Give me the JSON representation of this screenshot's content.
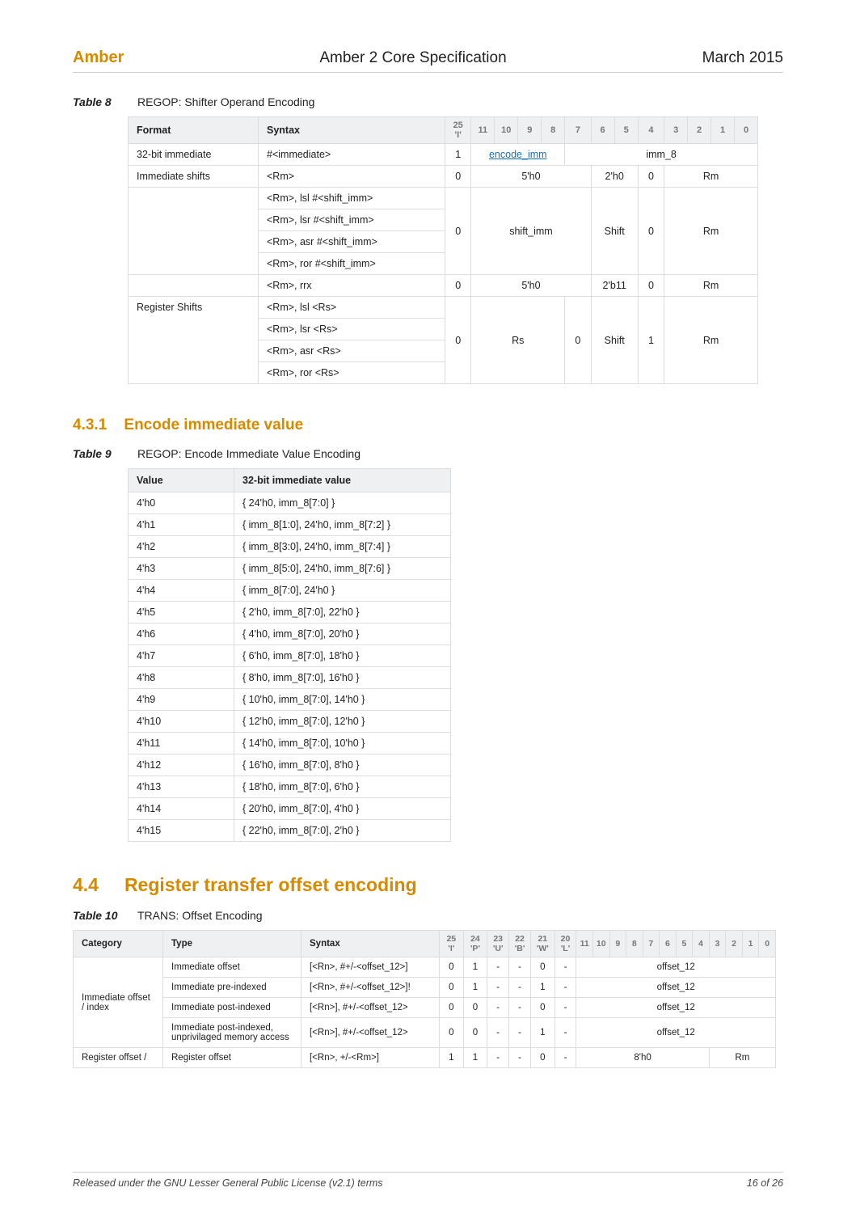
{
  "header": {
    "brand": "Amber",
    "title": "Amber 2 Core Specification",
    "date": "March 2015"
  },
  "table8": {
    "label": "Table 8",
    "caption": "REGOP: Shifter Operand Encoding",
    "headers": {
      "format": "Format",
      "syntax": "Syntax",
      "bit25": "25 'I'",
      "bits": [
        "11",
        "10",
        "9",
        "8",
        "7",
        "6",
        "5",
        "4",
        "3",
        "2",
        "1",
        "0"
      ]
    },
    "rows": [
      {
        "format": "32-bit immediate",
        "syntax": "#<immediate>",
        "i25": "1",
        "col_11_8": "encode_imm",
        "col_11_8_link": true,
        "col_7_0": "imm_8"
      },
      {
        "format": "Immediate shifts",
        "syntax": "<Rm>",
        "i25": "0",
        "col_11_7": "5'h0",
        "col_6_5": "2'h0",
        "col_4": "0",
        "col_3_0": "Rm"
      },
      {
        "format": "",
        "syntax": "<Rm>, lsl #<shift_imm>",
        "i25": "0",
        "col_11_7": "shift_imm",
        "col_6_5": "Shift",
        "col_4": "0",
        "col_3_0": "Rm",
        "grouped_below": true
      },
      {
        "format": "",
        "syntax": "<Rm>, lsr #<shift_imm>",
        "continuation": true
      },
      {
        "format": "",
        "syntax": "<Rm>, asr #<shift_imm>",
        "continuation": true
      },
      {
        "format": "",
        "syntax": "<Rm>, ror #<shift_imm>",
        "continuation": true
      },
      {
        "format": "",
        "syntax": "<Rm>, rrx",
        "i25": "0",
        "col_11_7": "5'h0",
        "col_6_5": "2'b11",
        "col_4": "0",
        "col_3_0": "Rm"
      },
      {
        "format": "Register Shifts",
        "syntax": "<Rm>, lsl <Rs>",
        "i25": "0",
        "col_11_8b": "Rs",
        "col_7": "0",
        "col_6_5": "Shift",
        "col_4": "1",
        "col_3_0": "Rm",
        "grouped_below": true
      },
      {
        "format": "",
        "syntax": "<Rm>, lsr <Rs>",
        "continuation": true
      },
      {
        "format": "",
        "syntax": "<Rm>, asr <Rs>",
        "continuation": true
      },
      {
        "format": "",
        "syntax": "<Rm>, ror <Rs>",
        "continuation": true
      }
    ]
  },
  "section431": {
    "number": "4.3.1",
    "title": "Encode immediate value"
  },
  "table9": {
    "label": "Table 9",
    "caption": "REGOP: Encode Immediate Value Encoding",
    "headers": {
      "value": "Value",
      "imm": "32-bit immediate value"
    },
    "rows": [
      {
        "v": "4'h0",
        "i": "{ 24'h0, imm_8[7:0] }"
      },
      {
        "v": "4'h1",
        "i": "{ imm_8[1:0], 24'h0, imm_8[7:2] }"
      },
      {
        "v": "4'h2",
        "i": "{ imm_8[3:0], 24'h0, imm_8[7:4] }"
      },
      {
        "v": "4'h3",
        "i": "{ imm_8[5:0], 24'h0, imm_8[7:6] }"
      },
      {
        "v": "4'h4",
        "i": "{ imm_8[7:0], 24'h0 }"
      },
      {
        "v": "4'h5",
        "i": "{ 2'h0, imm_8[7:0], 22'h0 }"
      },
      {
        "v": "4'h6",
        "i": "{ 4'h0, imm_8[7:0], 20'h0 }"
      },
      {
        "v": "4'h7",
        "i": "{ 6'h0, imm_8[7:0], 18'h0 }"
      },
      {
        "v": "4'h8",
        "i": "{ 8'h0, imm_8[7:0], 16'h0 }"
      },
      {
        "v": "4'h9",
        "i": "{ 10'h0, imm_8[7:0], 14'h0 }"
      },
      {
        "v": "4'h10",
        "i": "{ 12'h0, imm_8[7:0], 12'h0 }"
      },
      {
        "v": "4'h11",
        "i": "{ 14'h0, imm_8[7:0], 10'h0 }"
      },
      {
        "v": "4'h12",
        "i": "{ 16'h0, imm_8[7:0], 8'h0 }"
      },
      {
        "v": "4'h13",
        "i": "{ 18'h0, imm_8[7:0], 6'h0 }"
      },
      {
        "v": "4'h14",
        "i": "{ 20'h0, imm_8[7:0], 4'h0 }"
      },
      {
        "v": "4'h15",
        "i": "{ 22'h0, imm_8[7:0], 2'h0 }"
      }
    ]
  },
  "section44": {
    "number": "4.4",
    "title": "Register transfer offset encoding"
  },
  "table10": {
    "label": "Table 10",
    "caption": "TRANS: Offset Encoding",
    "headers": {
      "category": "Category",
      "type": "Type",
      "syntax": "Syntax",
      "b25": "25 'I'",
      "b24": "24 'P'",
      "b23": "23 'U'",
      "b22": "22 'B'",
      "b21": "21 'W'",
      "b20": "20 'L'",
      "bits": [
        "11",
        "10",
        "9",
        "8",
        "7",
        "6",
        "5",
        "4",
        "3",
        "2",
        "1",
        "0"
      ]
    },
    "rows": [
      {
        "category": "Immediate offset / index",
        "type": "Immediate offset",
        "syntax": "[<Rn>, #+/-<offset_12>]",
        "b25": "0",
        "b24": "1",
        "b23": "-",
        "b22": "-",
        "b21": "0",
        "b20": "-",
        "col_11_0": "offset_12"
      },
      {
        "category": "",
        "type": "Immediate pre-indexed",
        "syntax": "[<Rn>, #+/-<offset_12>]!",
        "b25": "0",
        "b24": "1",
        "b23": "-",
        "b22": "-",
        "b21": "1",
        "b20": "-",
        "col_11_0": "offset_12"
      },
      {
        "category": "",
        "type": "Immediate post-indexed",
        "syntax": "[<Rn>], #+/-<offset_12>",
        "b25": "0",
        "b24": "0",
        "b23": "-",
        "b22": "-",
        "b21": "0",
        "b20": "-",
        "col_11_0": "offset_12"
      },
      {
        "category": "",
        "type": "Immediate post-indexed, unprivilaged memory access",
        "syntax": "[<Rn>], #+/-<offset_12>",
        "b25": "0",
        "b24": "0",
        "b23": "-",
        "b22": "-",
        "b21": "1",
        "b20": "-",
        "col_11_0": "offset_12"
      },
      {
        "category": "Register offset /",
        "type": "Register offset",
        "syntax": "[<Rn>, +/-<Rm>]",
        "b25": "1",
        "b24": "1",
        "b23": "-",
        "b22": "-",
        "b21": "0",
        "b20": "-",
        "col_11_4": "8'h0",
        "col_3_0": "Rm"
      }
    ]
  },
  "footer": {
    "left": "Released under the GNU Lesser General Public License (v2.1) terms",
    "right": "16 of 26"
  }
}
